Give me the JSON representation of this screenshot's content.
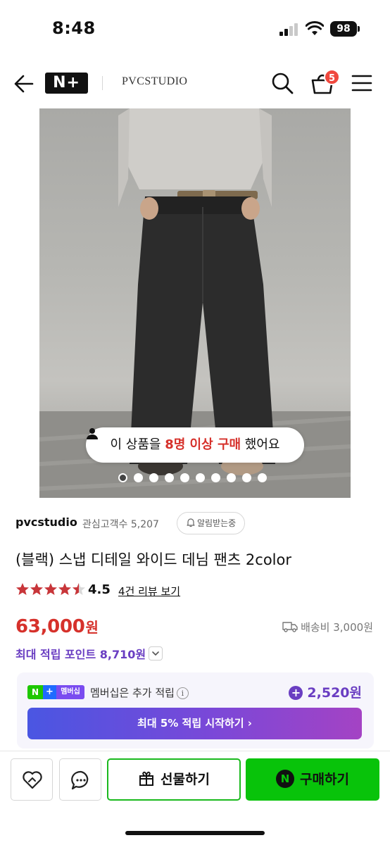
{
  "status_bar": {
    "time": "8:48",
    "battery": "98"
  },
  "header": {
    "logo_text": "N+",
    "brand": "PVCSTUDIO",
    "cart_count": "5",
    "icons": {
      "back": "arrow-left-icon",
      "search": "search-icon",
      "cart": "cart-icon",
      "menu": "hamburger-menu-icon"
    }
  },
  "gallery": {
    "purchase_notice": {
      "prefix": "이 상품을",
      "highlight": "8명 이상 구매",
      "suffix": "했어요"
    },
    "slide_count": 10,
    "active_slide": 1
  },
  "store": {
    "name": "pvcstudio",
    "follower_label": "관심고객수 5,207",
    "notify_label": "알림받는중"
  },
  "product": {
    "title": "(블랙) 스냅 디테일 와이드 데님 팬츠 2color",
    "rating": "4.5",
    "review_link": "4건 리뷰 보기",
    "price": "63,000",
    "price_unit": "원",
    "shipping": "배송비 3,000원",
    "max_points": "최대 적립 포인트 8,710원"
  },
  "membership": {
    "badge_n": "N",
    "badge_plus": "+",
    "badge_label": "멤버십",
    "text": "멤버십은 추가 적립",
    "bonus": "2,520원",
    "cta": "최대 5% 적립 시작하기 ›"
  },
  "bottom_bar": {
    "gift_label": "선물하기",
    "buy_label": "구매하기",
    "buy_icon_text": "N"
  },
  "colors": {
    "price_red": "#d6312b",
    "points_purple": "#6a3ec2",
    "naver_green": "#08c30a",
    "gift_border": "#1ab91d"
  }
}
